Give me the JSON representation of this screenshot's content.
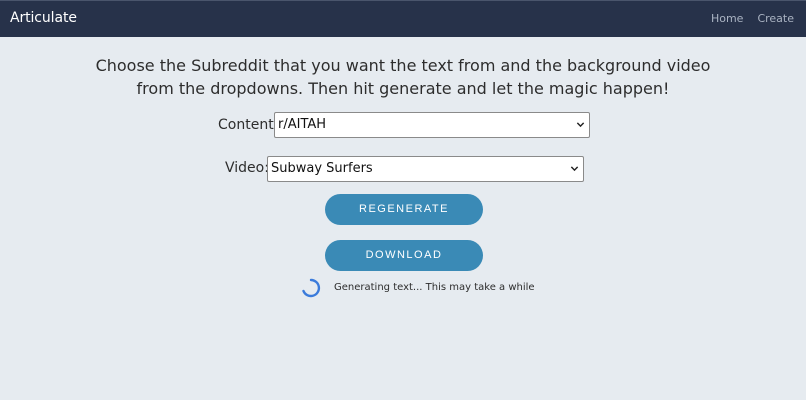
{
  "app": {
    "brand": "Articulate"
  },
  "nav": {
    "home": "Home",
    "create": "Create"
  },
  "intro": {
    "line1": "Choose the Subreddit that you want the text from and the background video",
    "line2": "from the dropdowns. Then hit generate and let the magic happen!"
  },
  "content_field": {
    "label": "Content:",
    "selected": "r/AITAH"
  },
  "video_field": {
    "label": "Video:",
    "selected": "Subway Surfers"
  },
  "buttons": {
    "regenerate": "REGENERATE",
    "download": "DOWNLOAD"
  },
  "status": {
    "text": "Generating text... This may take a while",
    "icon": "loading-spinner-icon"
  },
  "colors": {
    "navbar": "#27324a",
    "background": "#e6ebf0",
    "button": "#3a8ab6",
    "spinner": "#3b7bdb"
  }
}
